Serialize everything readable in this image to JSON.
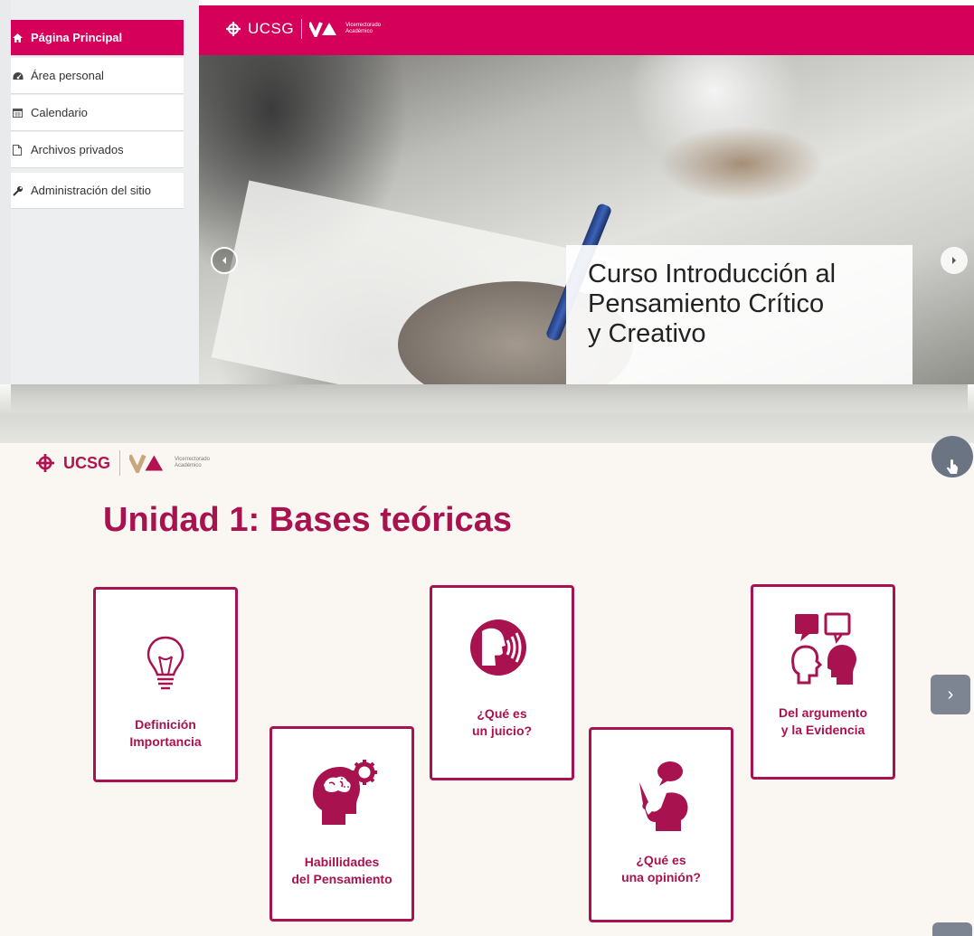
{
  "sidebar": {
    "items": [
      {
        "label": "Página Principal",
        "icon": "home-icon",
        "active": true
      },
      {
        "label": "Área personal",
        "icon": "dashboard-icon",
        "active": false
      },
      {
        "label": "Calendario",
        "icon": "calendar-icon",
        "active": false
      },
      {
        "label": "Archivos privados",
        "icon": "file-icon",
        "active": false
      },
      {
        "label": "Administración del sitio",
        "icon": "wrench-icon",
        "active": false
      }
    ]
  },
  "banner": {
    "brand": {
      "ucsg": "UCSG",
      "va_line1": "Vicerrectorado",
      "va_line2": "Académico"
    },
    "caption_lines": [
      "Curso Introducción al",
      "Pensamiento Crítico",
      "y Creativo"
    ]
  },
  "unit": {
    "brand": {
      "ucsg": "UCSG",
      "va_line1": "Vicerrectorado",
      "va_line2": "Académico"
    },
    "title": "Unidad 1: Bases teóricas",
    "cards": [
      {
        "lines": [
          "Definición",
          "Importancia"
        ],
        "icon": "lightbulb-icon"
      },
      {
        "lines": [
          "Habillidades",
          "del Pensamiento"
        ],
        "icon": "brain-gear-icon"
      },
      {
        "lines": [
          "¿Qué es",
          "un juicio?"
        ],
        "icon": "speaking-head-icon"
      },
      {
        "lines": [
          "¿Qué es",
          "una opinión?"
        ],
        "icon": "opinion-head-icon"
      },
      {
        "lines": [
          "Del argumento",
          "y la Evidencia"
        ],
        "icon": "dialogue-heads-icon"
      }
    ],
    "next_label": "›"
  },
  "colors": {
    "brand": "#d4005a",
    "card_border": "#a8124f",
    "nav_button": "#7c8591"
  }
}
